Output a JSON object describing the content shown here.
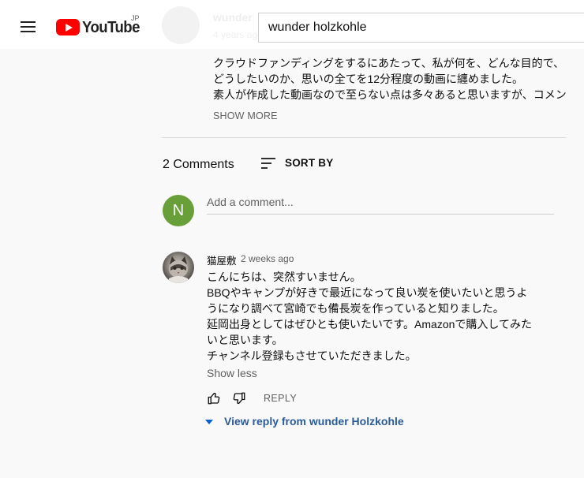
{
  "header": {
    "logo_text": "YouTube",
    "country_code": "JP",
    "search_value": "wunder holzkohle"
  },
  "video": {
    "channel_name_faded": "wunder",
    "date_faded": "4 years ago",
    "description_lines": [
      "クラウドファンディングをするにあたって、私が何を、どんな目的で、",
      "どうしたいのか、思いの全てを12分程度の動画に纏めました。",
      "素人が作成した動画なので至らない点は多々あると思いますが、コメン"
    ],
    "show_more_label": "SHOW MORE"
  },
  "comments": {
    "count_label": "2 Comments",
    "sort_label": "SORT BY",
    "add_placeholder": "Add a comment...",
    "user_initial": "N",
    "user_avatar_color": "#689f38"
  },
  "comment": {
    "author": "猫屋敷",
    "time": "2 weeks ago",
    "body_lines": [
      "こんにちは、突然すいません。",
      "BBQやキャンプが好きで最近になって良い炭を使いたいと思うよ",
      "うになり調べて宮崎でも備長炭を作っていると知りました。",
      "延岡出身としてはぜひとも使いたいです。Amazonで購入してみた",
      "いと思います。",
      "チャンネル登録もさせていただきました。"
    ],
    "show_less_label": "Show less",
    "reply_label": "REPLY",
    "view_reply_label": "View reply from wunder Holzkohle",
    "like_icon": "thumbs-up-icon",
    "dislike_icon": "thumbs-down-icon"
  },
  "colors": {
    "brand_red": "#ff0000",
    "link_blue": "#065fd4",
    "background": "#f9f9f9"
  }
}
